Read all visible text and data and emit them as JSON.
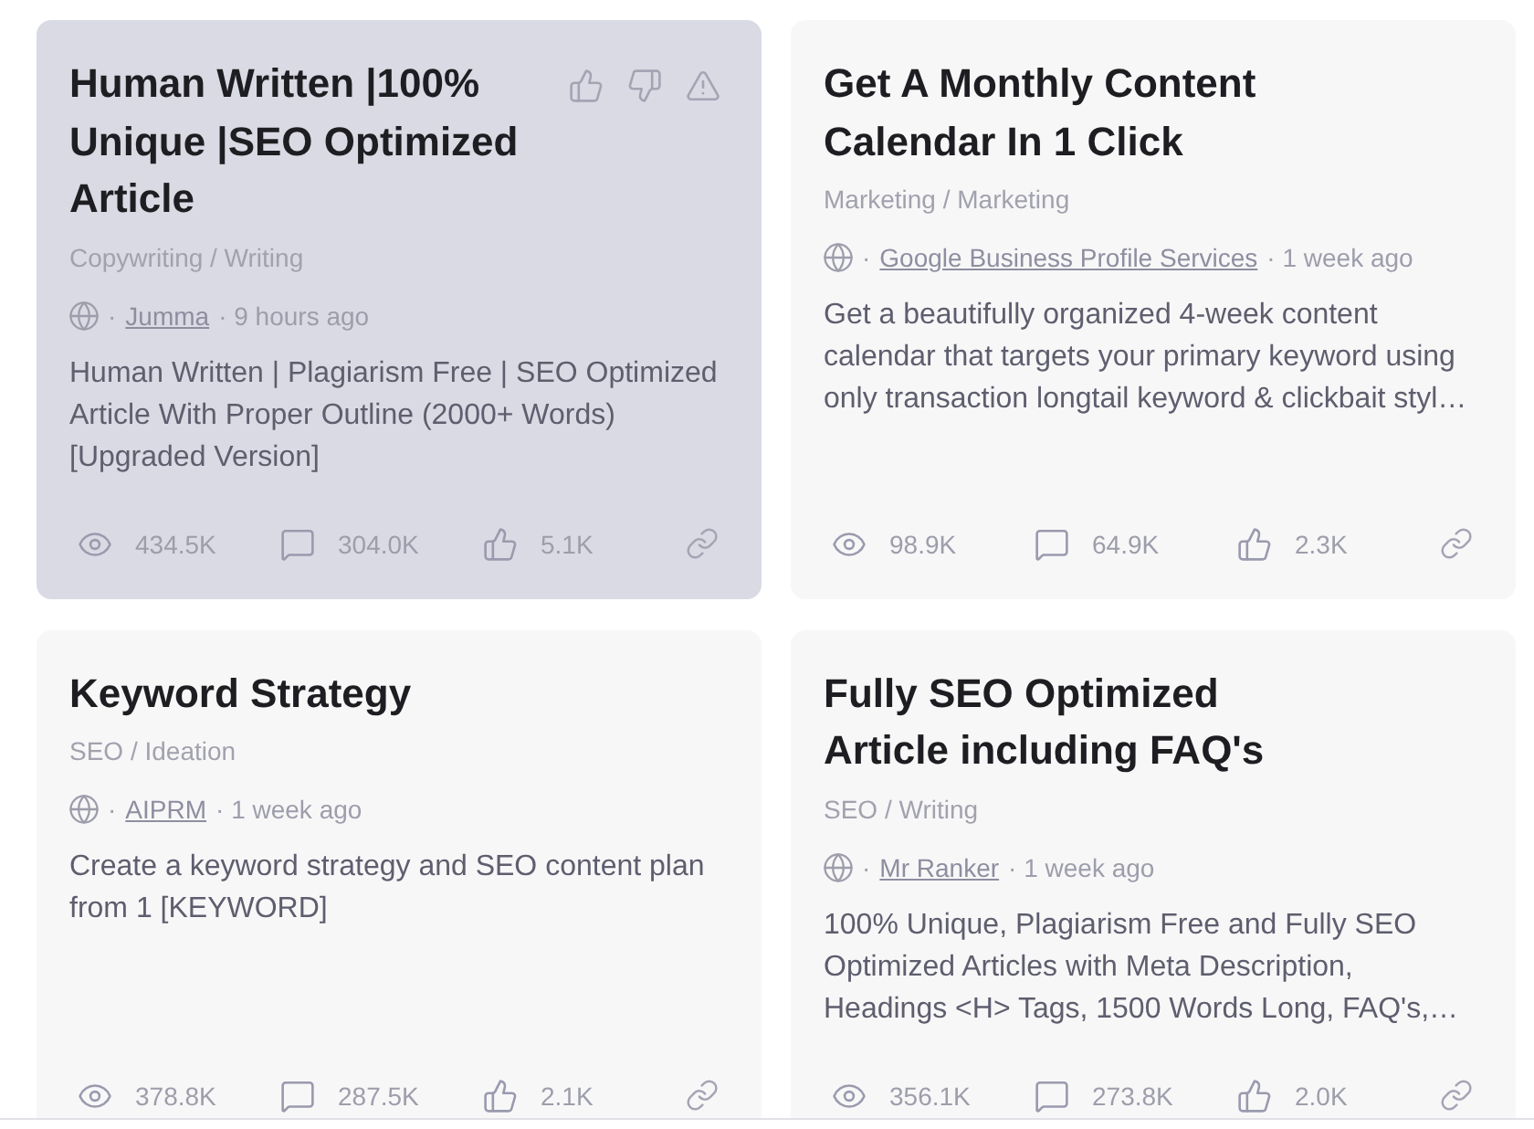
{
  "cards": [
    {
      "title": "Human Written |100% Unique |SEO Optimized Article",
      "hovered": true,
      "category": "Copywriting / Writing",
      "author_prefix": "·",
      "author": "Jumma",
      "age": "· 9 hours ago",
      "description": "Human Written | Plagiarism Free | SEO Optimized Article With Proper Outline (2000+ Words) [Upgraded Version]",
      "stats": [
        {
          "kind": "views",
          "value": "434.5K"
        },
        {
          "kind": "comments",
          "value": "304.0K"
        },
        {
          "kind": "likes",
          "value": "5.1K"
        }
      ]
    },
    {
      "title": "Get A Monthly Content Calendar In 1 Click",
      "hovered": false,
      "category": "Marketing / Marketing",
      "author_prefix": "·",
      "author": "Google Business Profile Services",
      "age": "· 1 week ago",
      "description": "Get a beautifully organized 4-week content calendar that targets your primary keyword using only transaction longtail keyword & clickbait styl…",
      "stats": [
        {
          "kind": "views",
          "value": "98.9K"
        },
        {
          "kind": "comments",
          "value": "64.9K"
        },
        {
          "kind": "likes",
          "value": "2.3K"
        }
      ]
    },
    {
      "title": "Keyword Strategy",
      "hovered": false,
      "category": "SEO / Ideation",
      "author_prefix": "·",
      "author": "AIPRM",
      "age": "· 1 week ago",
      "description": "Create a keyword strategy and SEO content plan from 1 [KEYWORD]",
      "stats": [
        {
          "kind": "views",
          "value": "378.8K"
        },
        {
          "kind": "comments",
          "value": "287.5K"
        },
        {
          "kind": "likes",
          "value": "2.1K"
        }
      ]
    },
    {
      "title": "Fully SEO Optimized Article including FAQ's",
      "hovered": false,
      "category": "SEO / Writing",
      "author_prefix": "·",
      "author": "Mr Ranker",
      "age": "· 1 week ago",
      "description": "100% Unique, Plagiarism Free and Fully SEO Optimized Articles with Meta Description, Headings <H> Tags, 1500 Words Long, FAQ's,…",
      "stats": [
        {
          "kind": "views",
          "value": "356.1K"
        },
        {
          "kind": "comments",
          "value": "273.8K"
        },
        {
          "kind": "likes",
          "value": "2.0K"
        }
      ]
    }
  ]
}
